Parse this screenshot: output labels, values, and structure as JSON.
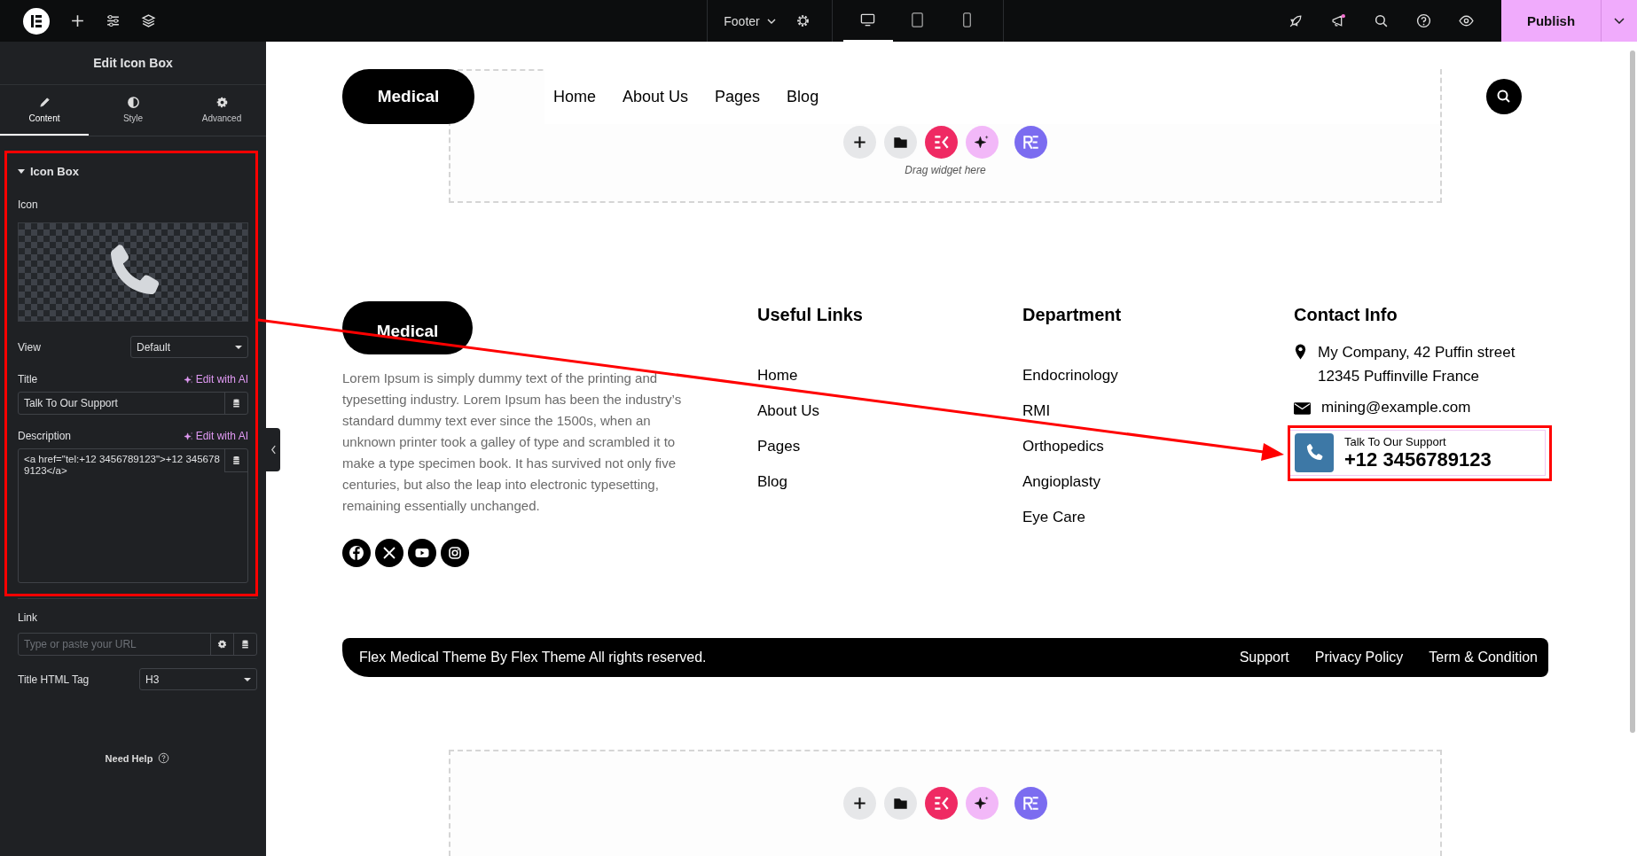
{
  "topbar": {
    "template": "Footer",
    "devices": [
      {
        "kind": "desktop",
        "selected": true
      },
      {
        "kind": "tablet",
        "selected": false
      },
      {
        "kind": "mobile",
        "selected": false
      }
    ],
    "publish": "Publish"
  },
  "panel": {
    "title": "Edit Icon Box",
    "tabs": [
      {
        "kind": "content",
        "label": "Content",
        "selected": true
      },
      {
        "kind": "style",
        "label": "Style",
        "selected": false
      },
      {
        "kind": "advanced",
        "label": "Advanced",
        "selected": false
      }
    ],
    "section": {
      "title": "Icon Box",
      "expanded": true
    },
    "icon_label": "Icon",
    "view": {
      "label": "View",
      "value": "Default"
    },
    "title_field": {
      "label": "Title",
      "ai": "Edit with AI",
      "value": "Talk To Our Support"
    },
    "description": {
      "label": "Description",
      "ai": "Edit with AI",
      "value": "<a href=\"tel:+12 3456789123\">+12 3456789123</a>"
    },
    "link": {
      "label": "Link",
      "placeholder": "Type or paste your URL"
    },
    "html_tag": {
      "label": "Title HTML Tag",
      "value": "H3"
    },
    "help": "Need Help"
  },
  "canvas": {
    "header": {
      "logo": "Medical",
      "nav": [
        "Home",
        "About Us",
        "Pages",
        "Blog"
      ]
    },
    "drop_hint": "Drag widget here",
    "footer": {
      "logo": "Medical",
      "about": "Lorem Ipsum is simply dummy text of the printing and typesetting industry. Lorem Ipsum has been the industry’s standard dummy text ever since the 1500s, when an unknown printer took a galley of type and scrambled it to make a type specimen book. It has survived not only five centuries, but also the leap into electronic typesetting, remaining essentially unchanged.",
      "socials": [
        {
          "kind": "facebook"
        },
        {
          "kind": "x"
        },
        {
          "kind": "youtube"
        },
        {
          "kind": "instagram"
        }
      ],
      "columns": [
        {
          "title": "Useful Links",
          "items": [
            "Home",
            "About Us",
            "Pages",
            "Blog"
          ]
        },
        {
          "title": "Department",
          "items": [
            "Endocrinology",
            "RMI",
            "Orthopedics",
            "Angioplasty",
            "Eye Care"
          ]
        }
      ],
      "contact": {
        "title": "Contact Info",
        "address_lines": [
          "My Company, 42 Puffin street",
          "12345 Puffinville France"
        ],
        "email": "mining@example.com",
        "support": {
          "title": "Talk To Our Support",
          "phone": "+12 3456789123"
        }
      }
    },
    "bottom_bar": {
      "copyright": "Flex Medical Theme By Flex Theme All rights reserved.",
      "links": [
        "Support",
        "Privacy Policy",
        "Term & Condition"
      ]
    }
  }
}
